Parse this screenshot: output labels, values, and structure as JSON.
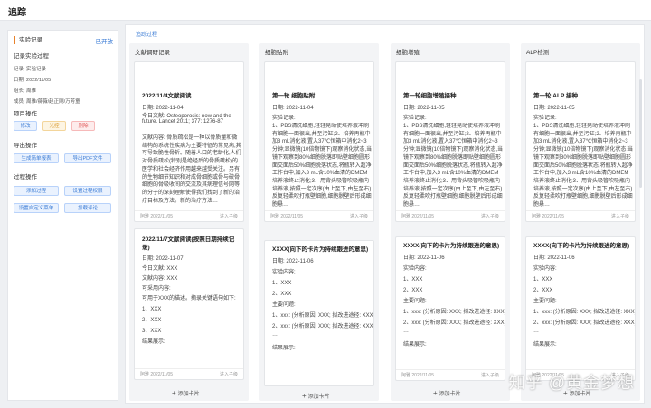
{
  "page": {
    "title": "追踪"
  },
  "sidebar": {
    "heading": "实验记录",
    "open_link": "已开放",
    "section_record": "记录实验过程",
    "meta": [
      "记录:   实验记录",
      "日期:   2022/11/05",
      "组长:   周雅",
      "成员:   周雅/薇薇/赵正刚/万芳童"
    ],
    "section_ops": "项目操作",
    "ops_buttons": [
      "修改",
      "光控",
      "删除"
    ],
    "section_export": "导出操作",
    "export_buttons": [
      "生成简单报表",
      "导出PDF文件"
    ],
    "section_process": "过程操作",
    "process_buttons": [
      "添加过程",
      "设置过程权限",
      "设置自定义菜单",
      "加载评论"
    ]
  },
  "main": {
    "tab": "追踪过程",
    "columns": [
      {
        "title": "文献调研记录",
        "cards": [
          {
            "title": "2022/11/4文献阅读",
            "lines": [
              "日期: 2022-11-04",
              "今日文献: Osteoporosis: now and the",
              "future. Lancet 2011; 377: 1276-87"
            ],
            "body": "文献内容: 骨质疏松是一种以骨质量和微结构的系统性疾病为主要特征的常见病,其可导致脆性骨折。随着人口的老龄化,人们对骨质疏松(特别是绝经后的骨质疏松)的医学和社会经济作用越来越受关注。另有的生物细节知识和对成骨细胞或骨与破骨细胞的骨吸收间的交流及其病理信号网等的分子的深刻理解使得我们找到了新的治疗目标及方法。新的治疗方法…",
            "foot_date": "阿雅 2022/11/05",
            "foot_action": "进入子级"
          },
          {
            "title": "2022/11/7文献阅读(按照日期持续记录)",
            "lines": [
              "日期: 2022-11-07",
              "今日文献: XXX",
              "文献内容: XXX",
              "可采用内容:",
              "可用于XXX的描述。摘录关键语句如下:",
              "1、XXX",
              "2、XXX",
              "3、XXX",
              "结果展示:"
            ],
            "foot_date": "阿雅 2022/11/05",
            "foot_action": "进入子级"
          }
        ],
        "add_label": "添加卡片"
      },
      {
        "title": "细胞贴附",
        "cards": [
          {
            "title": "第一轮 细胞贴附",
            "lines": [
              "日期: 2022-11-04",
              "实验记录:"
            ],
            "body": "1、PBS清洗细胞,轻轻晃动使培养液冲刷有细胞一面很出,并至污缸;2、培养再瓶中加3 mL消化液,置入37℃恒箱中消化2~3分钟;显微镜(10倍物镜下)观察消化状态,当镜下观察到80%细胞脱落即贴壁细胞圆形面交面后50%细胞脱落状态,将瓶转入超净工作台中,加入3 mL含10%血清的DMEM 培养液终止消化;3、用背头吸管吹吸瓶内培养液,按照一定次序(由上至下,由左至右)反复轻柔吹打瓶壁细胞,细胞脱壁后形成细胞悬…",
            "foot_date": "阿雅 2022/11/05",
            "foot_action": "进入子级"
          },
          {
            "title": "XXXX(向下的卡片为持续跟进的意思)",
            "lines": [
              "日期: 2022-11-06",
              "实验内容:",
              "1、XXX",
              "2、XXX",
              "主要问题:",
              "1、xxx: (分析原因: XXX; 拟改进途径: XXX)",
              "2、xxx: (分析原因: XXX; 拟改进途径: XXX)",
              "…",
              "结果展示:"
            ],
            "foot_date": "",
            "foot_action": ""
          }
        ],
        "add_label": "添加卡片"
      },
      {
        "title": "细胞增殖",
        "cards": [
          {
            "title": "第一轮细胞增殖接种",
            "lines": [
              "日期: 2022-11-05",
              "实验记录:"
            ],
            "body": "1、PBS清洗细胞,轻轻晃动使培养液冲刷有细胞一面很出,并至污缸;2、培养再瓶中加3 mL消化液,置入37℃恒箱中消化2~3分钟;显微镜(10倍物镜下)观察消化状态,当镜下观察到80%细胞脱落即贴壁细胞圆形面交面后50%细胞脱落状态,将瓶转入超净工作台中,加入3 mL含10%血清的DMEM 培养液终止消化;3、用背头吸管吹吸瓶内培养液,按照一定次序(由上至下,由左至右)反复轻柔吹打瓶壁细胞,细胞脱壁后形成细胞悬…",
            "foot_date": "阿雅 2022/11/05",
            "foot_action": "进入子级"
          },
          {
            "title": "XXXX(向下的卡片为持续跟进的意思)",
            "lines": [
              "日期: 2022-11-06",
              "实验内容:",
              "1、XXX",
              "2、XXX",
              "主要问题:",
              "1、xxx: (分析原因: XXX; 拟改进途径: XXX)",
              "2、xxx: (分析原因: XXX; 拟改进途径: XXX)",
              "…",
              "结果展示:"
            ],
            "foot_date": "阿雅 2022/11/05",
            "foot_action": "进入子级"
          }
        ],
        "add_label": "添加卡片"
      },
      {
        "title": "ALP检测",
        "cards": [
          {
            "title": "第一轮 ALP 接种",
            "lines": [
              "日期: 2022-11-05",
              "实验记录:"
            ],
            "body": "1、PBS清洗细胞,轻轻晃动使培养液冲刷有细胞一面很出,并至污缸;2、培养再瓶中加3 mL消化液,置入37℃恒箱中消化2~3分钟;显微镜(10倍物镜下)观察消化状态,当镜下观察到80%细胞脱落即贴壁细胞圆形面交面后50%细胞脱落状态,将瓶转入超净工作台中,加入3 mL含10%血清的DMEM 培养液终止消化;3、用背头吸管吹吸瓶内培养液,按照一定次序(由上至下,由左至右)反复轻柔吹打瓶壁细胞,细胞脱壁后形成细胞悬…",
            "foot_date": "阿雅 2022/11/05",
            "foot_action": "进入子级"
          },
          {
            "title": "XXXX(向下的卡片为持续跟进的意思)",
            "lines": [
              "日期: 2022-11-06",
              "实验内容:",
              "1、XXX",
              "2、XXX",
              "主要问题:",
              "1、xxx: (分析原因: XXX; 拟改进途径: XXX)",
              "2、xxx: (分析原因: XXX; 拟改进途径: XXX)",
              "…",
              "结果展示:"
            ],
            "foot_date": "阿雅 2022/11/05",
            "foot_action": "进入子级"
          }
        ],
        "add_label": "添加卡片"
      }
    ]
  },
  "watermark": "知乎 @黄金梦想"
}
